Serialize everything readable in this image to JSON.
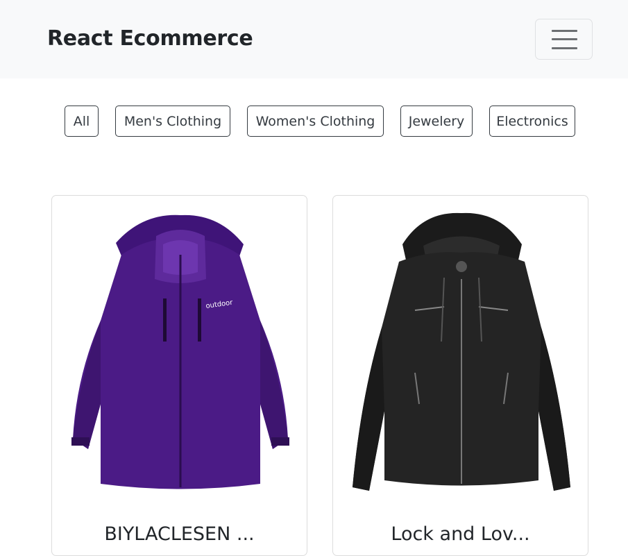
{
  "navbar": {
    "brand": "React Ecommerce",
    "toggler_icon": "hamburger-menu-icon"
  },
  "filters": [
    {
      "label": "All"
    },
    {
      "label": "Men's Clothing"
    },
    {
      "label": "Women's Clothing"
    },
    {
      "label": "Jewelery"
    },
    {
      "label": "Electronics"
    }
  ],
  "products": [
    {
      "title": "BIYLACLESEN ...",
      "image": "purple-jacket-image",
      "color": "#4b1b86"
    },
    {
      "title": "Lock and Lov...",
      "image": "black-leather-jacket-image",
      "color": "#222222"
    }
  ]
}
